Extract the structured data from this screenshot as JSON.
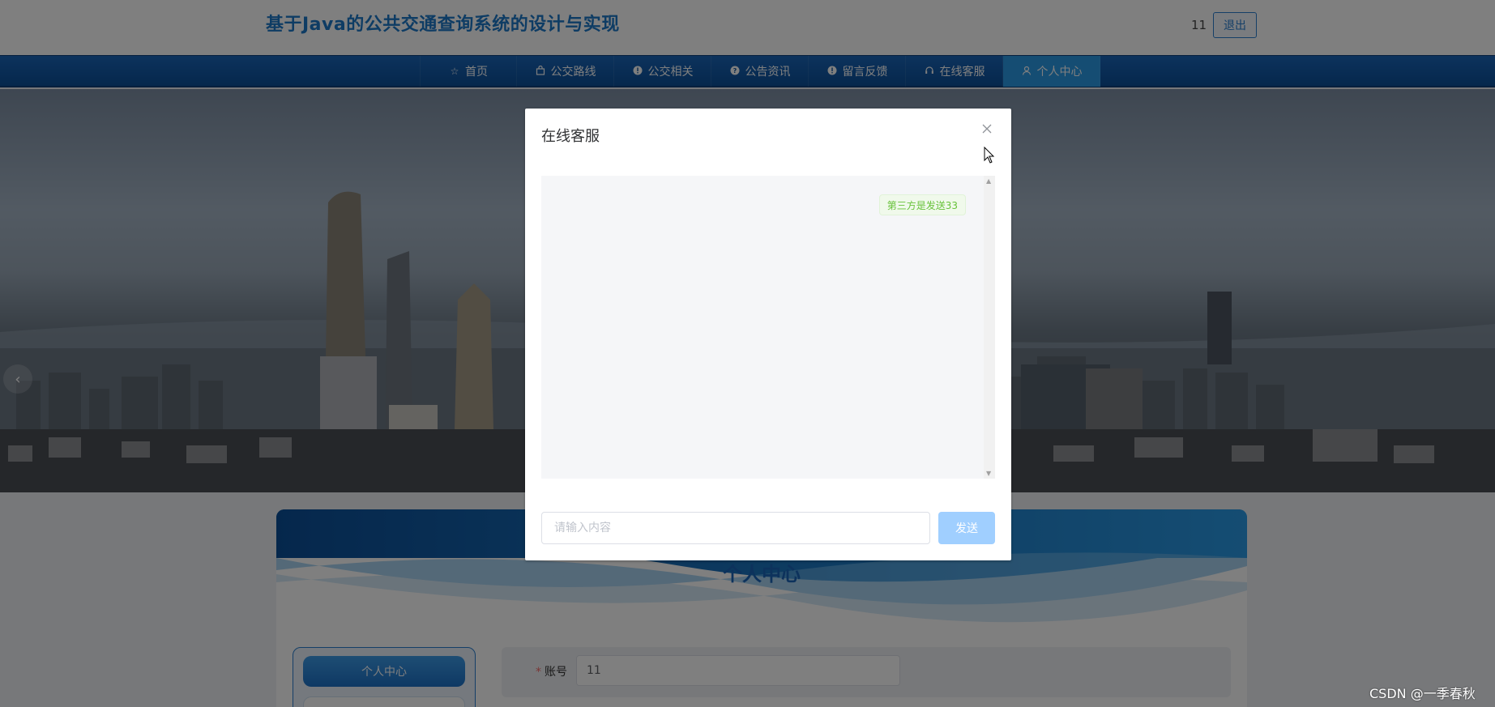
{
  "header": {
    "site_title": "基于Java的公共交通查询系统的设计与实现",
    "user_name": "11",
    "logout_label": "退出"
  },
  "nav": {
    "items": [
      {
        "label": "首页",
        "icon": "star-icon"
      },
      {
        "label": "公交路线",
        "icon": "bag-icon"
      },
      {
        "label": "公交相关",
        "icon": "info-icon"
      },
      {
        "label": "公告资讯",
        "icon": "question-icon"
      },
      {
        "label": "留言反馈",
        "icon": "info-icon"
      },
      {
        "label": "在线客服",
        "icon": "headset-icon"
      },
      {
        "label": "个人中心",
        "icon": "user-icon"
      }
    ],
    "active_index": 6
  },
  "personal_center": {
    "title": "个人中心",
    "side_active_label": "个人中心",
    "form": {
      "account_label": "账号",
      "account_value": "11"
    }
  },
  "dialog": {
    "title": "在线客服",
    "messages": [
      {
        "text": "第三方是发送33"
      }
    ],
    "input_placeholder": "请输入内容",
    "send_label": "发送"
  },
  "watermark": "CSDN @一季春秋",
  "colors": {
    "brand": "#1d78c8",
    "nav_bg": "#0b4f99",
    "nav_active": "#2a9ae6",
    "send_btn": "#a0cfff",
    "message_text": "#67c23a"
  }
}
